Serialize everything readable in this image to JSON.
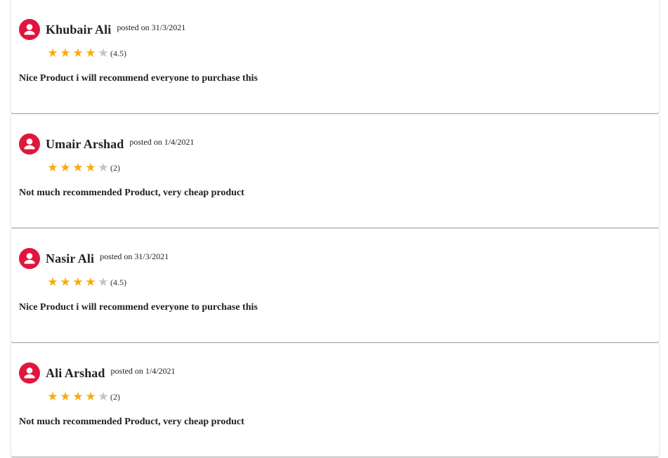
{
  "colors": {
    "avatar": "#e0163d",
    "star_filled": "#f4ad0f",
    "star_empty": "#c4c4c4"
  },
  "reviews": [
    {
      "name": "Khubair Ali",
      "posted": "posted on 31/3/2021",
      "rating": 4.5,
      "rating_text": "(4.5)",
      "stars_filled": 4,
      "comment": "Nice Product i will recommend everyone to purchase this"
    },
    {
      "name": "Umair Arshad",
      "posted": "posted on 1/4/2021",
      "rating": 2,
      "rating_text": "(2)",
      "stars_filled": 4,
      "comment": "Not much recommended Product, very cheap product"
    },
    {
      "name": "Nasir Ali",
      "posted": "posted on 31/3/2021",
      "rating": 4.5,
      "rating_text": "(4.5)",
      "stars_filled": 4,
      "comment": "Nice Product i will recommend everyone to purchase this"
    },
    {
      "name": "Ali Arshad",
      "posted": "posted on 1/4/2021",
      "rating": 2,
      "rating_text": "(2)",
      "stars_filled": 4,
      "comment": "Not much recommended Product, very cheap product"
    }
  ]
}
